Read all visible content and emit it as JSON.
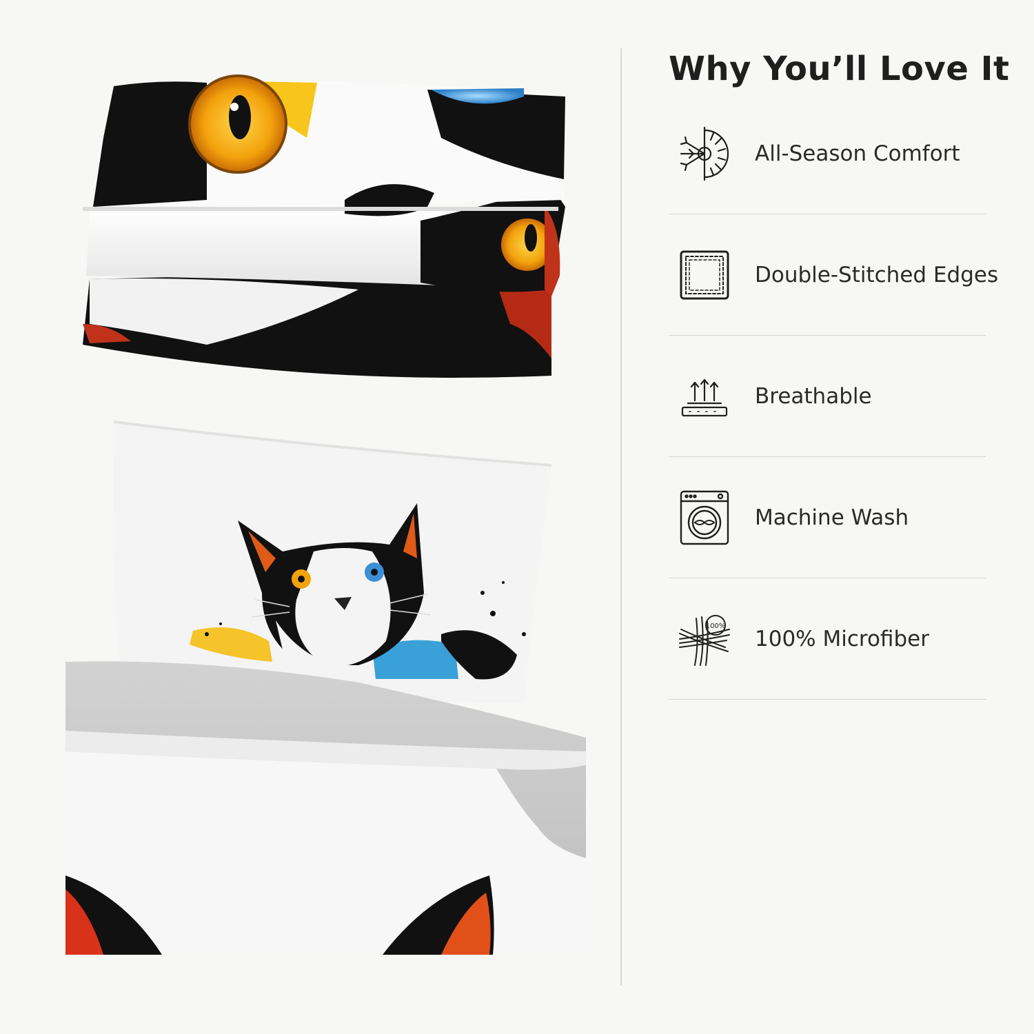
{
  "panel": {
    "title": "Why You’ll Love It",
    "features": [
      {
        "label": "All-Season Comfort",
        "icon": "sun-snowflake-icon"
      },
      {
        "label": "Double-Stitched Edges",
        "icon": "stitched-square-icon"
      },
      {
        "label": "Breathable",
        "icon": "airflow-arrows-icon"
      },
      {
        "label": "Machine Wash",
        "icon": "washing-machine-icon"
      },
      {
        "label": "100% Microfiber",
        "icon": "microfiber-fibers-icon"
      }
    ],
    "badge_text": "100%"
  },
  "colors": {
    "background": "#f7f7f5",
    "cat_orange_eye": "#f2a20c",
    "cat_blue_eye": "#3b8fd6",
    "paint_yellow": "#f5c32a",
    "paint_blue": "#3aa0d8",
    "ear_red": "#d8321a",
    "sheet_gray": "#c9c9c9"
  }
}
